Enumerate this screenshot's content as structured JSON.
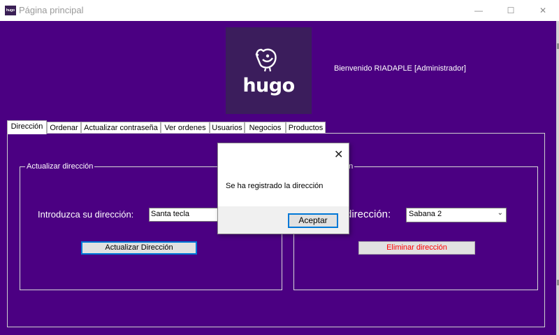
{
  "window": {
    "title": "Página principal",
    "minimize": "—",
    "maximize": "☐",
    "close": "✕"
  },
  "logo": {
    "icon_label": "hugo",
    "text": "hugo"
  },
  "welcome": "Bienvenido RIADAPLE [Administrador]",
  "tabs": [
    {
      "label": "Dirección",
      "active": true
    },
    {
      "label": "Ordenar"
    },
    {
      "label": "Actualizar contraseña"
    },
    {
      "label": "Ver ordenes"
    },
    {
      "label": "Usuarios"
    },
    {
      "label": "Negocios"
    },
    {
      "label": "Productos"
    }
  ],
  "update_group": {
    "title": "Actualizar dirección",
    "field_label": "Introduzca su dirección:",
    "field_value": "Santa tecla",
    "button": "Actualizar Dirección"
  },
  "delete_group": {
    "title_visible": "ón",
    "field_label_visible": "dirección:",
    "select_value": "Sabana 2",
    "button": "Eliminar dirección"
  },
  "dialog": {
    "message": "Se ha registrado la dirección",
    "ok": "Aceptar",
    "close": "✕"
  },
  "colors": {
    "background": "#4b0082",
    "logo_bg": "#3b1d5c",
    "focus": "#0078d7",
    "danger": "#ff0000"
  }
}
